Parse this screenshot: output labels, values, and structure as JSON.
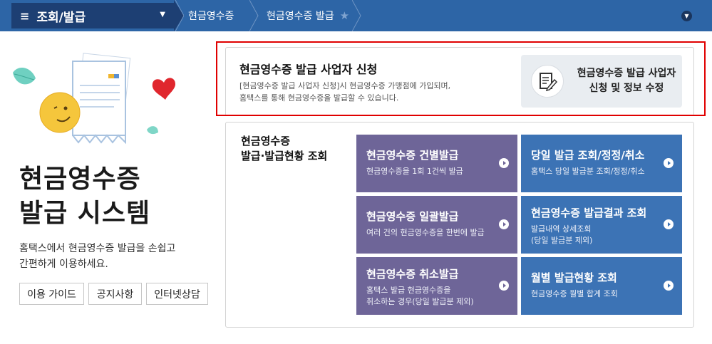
{
  "nav": {
    "menu_label": "조회/발급",
    "breadcrumbs": [
      "현금영수증",
      "현금영수증 발급"
    ]
  },
  "hero": {
    "title_line1": "현금영수증",
    "title_line2": "발급 시스템",
    "desc_line1": "홈택스에서 현금영수증 발급을 손쉽고",
    "desc_line2": "간편하게 이용하세요.",
    "buttons": [
      "이용 가이드",
      "공지사항",
      "인터넷상담"
    ]
  },
  "register": {
    "title": "현금영수증 발급 사업자 신청",
    "desc_line1": "[현금영수증 발급 사업자 신청]시 현금영수증 가맹점에 가입되며,",
    "desc_line2": "홈택스를 통해 현금영수증을 발급할 수 있습니다.",
    "button_line1": "현금영수증 발급 사업자",
    "button_line2": "신청 및 정보 수정"
  },
  "issue": {
    "title_line1": "현금영수증",
    "title_line2": "발급·발급현황 조회",
    "tiles": [
      {
        "title": "현금영수증 건별발급",
        "sub1": "현금영수증을 1회 1건씩 발급",
        "sub2": ""
      },
      {
        "title": "당일 발급 조회/정정/취소",
        "sub1": "홈택스 당일 발급분 조회/정정/취소",
        "sub2": ""
      },
      {
        "title": "현금영수증 일괄발급",
        "sub1": "여러 건의 현금영수증을 한번에 발급",
        "sub2": ""
      },
      {
        "title": "현금영수증 발급결과 조회",
        "sub1": "발급내역 상세조회",
        "sub2": "(당일 발급분 제외)"
      },
      {
        "title": "현금영수증 취소발급",
        "sub1": "홈택스 발급 현금영수증을",
        "sub2": "취소하는 경우(당일 발급분 제외)"
      },
      {
        "title": "월별 발급현황 조회",
        "sub1": "현금영수증 월별 합계 조회",
        "sub2": ""
      }
    ]
  },
  "colors": {
    "topbar": "#2d65a6",
    "menu": "#1d3f73",
    "tile_purple": "#6e6598",
    "tile_blue": "#3c73b5",
    "highlight": "#e00000"
  }
}
